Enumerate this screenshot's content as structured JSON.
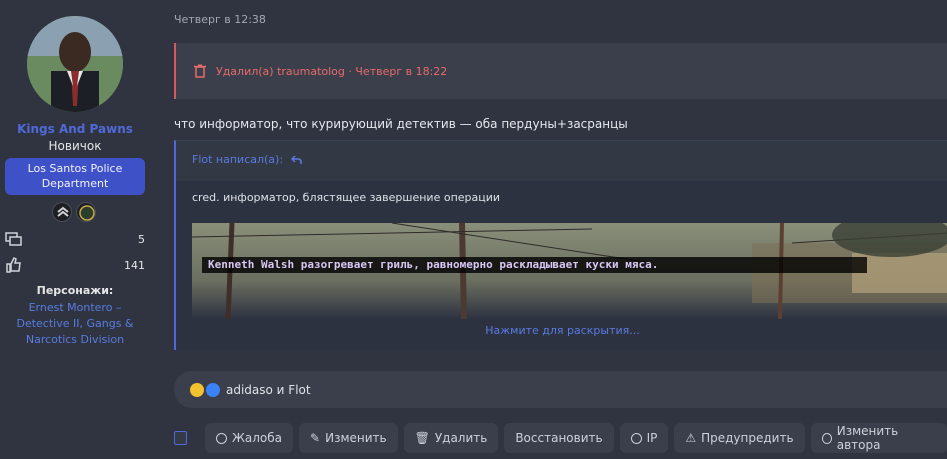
{
  "user": {
    "name": "Kings And Pawns",
    "title": "Новичок",
    "banner": "Los Santos Police Department",
    "stats": [
      {
        "icon": "messages-icon",
        "value": "5"
      },
      {
        "icon": "thumbs-up-icon",
        "value": "141"
      }
    ],
    "characters_label": "Персонажи:",
    "characters_value": "Ernest Montero – Detective II, Gangs & Narcotics Division"
  },
  "post": {
    "date": "Четверг в 12:38",
    "deleted_notice": "Удалил(а) traumatolog · Четверг в 18:22",
    "text": "что информатор, что курирующий детектив — оба пердуны+засранцы",
    "quote": {
      "author": "Flot написал(а):",
      "text": "cred. информатор, блястящее завершение операции",
      "image_caption": "Kenneth Walsh разогревает гриль, равномерно раскладывает куски мяса.",
      "expand": "Нажмите для раскрытия..."
    },
    "reactions_text": "adidaso и Flot"
  },
  "actions": [
    {
      "label": "Жалоба",
      "icon": "report-icon"
    },
    {
      "label": "Изменить",
      "icon": "pencil-icon"
    },
    {
      "label": "Удалить",
      "icon": "trash-icon"
    },
    {
      "label": "Восстановить",
      "icon": ""
    },
    {
      "label": "IP",
      "icon": "globe-icon"
    },
    {
      "label": "Предупредить",
      "icon": "warning-icon"
    },
    {
      "label": "Изменить автора",
      "icon": "globe-icon"
    }
  ],
  "colors": {
    "accent": "#4f6ad8",
    "danger": "#e86a6a",
    "banner": "#3f51c7"
  }
}
